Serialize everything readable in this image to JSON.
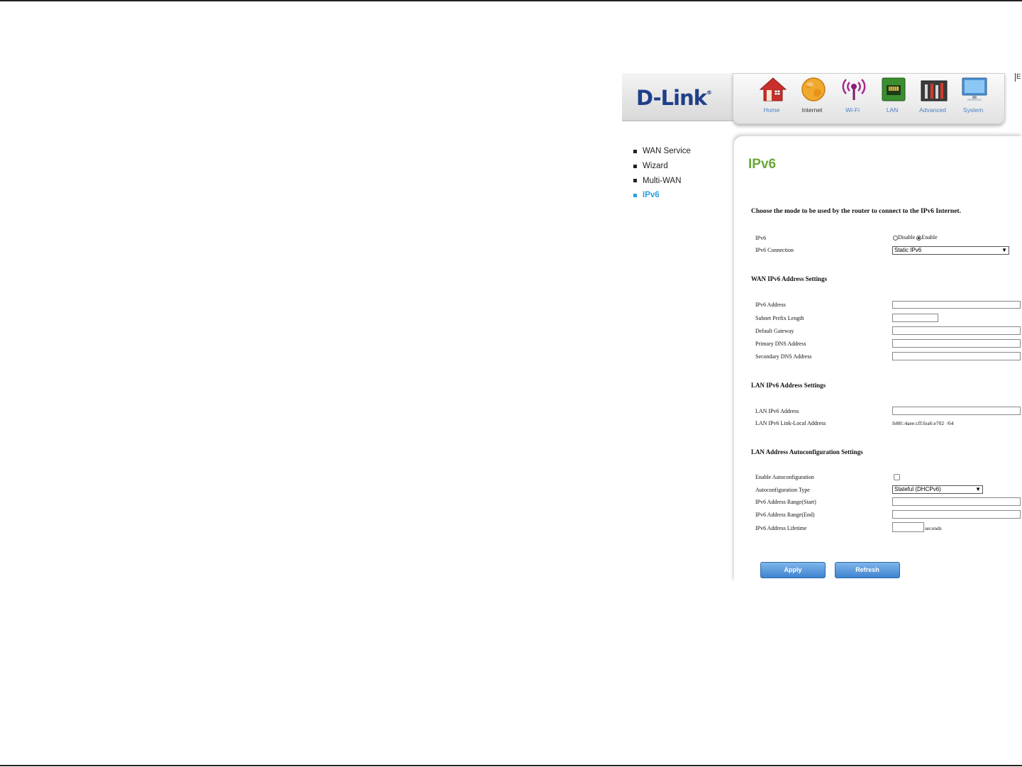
{
  "brand": {
    "logo_text": "D-Link",
    "logo_mark": "®"
  },
  "nav": [
    {
      "label": "Home",
      "icon": "home-icon"
    },
    {
      "label": "Internet",
      "icon": "globe-icon",
      "active": true
    },
    {
      "label": "Wi-Fi",
      "icon": "wifi-icon"
    },
    {
      "label": "LAN",
      "icon": "lan-port-icon"
    },
    {
      "label": "Advanced",
      "icon": "tools-icon"
    },
    {
      "label": "System",
      "icon": "monitor-icon"
    }
  ],
  "corner_text": "E",
  "sidebar": {
    "items": [
      {
        "label": "WAN Service"
      },
      {
        "label": "Wizard"
      },
      {
        "label": "Multi-WAN"
      },
      {
        "label": "IPv6",
        "active": true
      }
    ]
  },
  "page": {
    "title": "IPv6",
    "intro": "Choose the mode to be used by the router to connect to the IPv6 Internet."
  },
  "ipv6": {
    "label": "IPv6",
    "disable_label": "Disable",
    "enable_label": "Enable",
    "selected": "Enable",
    "connection_label": "IPv6 Connection",
    "connection_value": "Static IPv6"
  },
  "wan": {
    "heading": "WAN IPv6 Address Settings",
    "address_label": "IPv6 Address",
    "prefix_label": "Subnet Prefix Length",
    "gateway_label": "Default Gateway",
    "primary_dns_label": "Primary DNS Address",
    "secondary_dns_label": "Secondary DNS Address"
  },
  "lan": {
    "heading": "LAN IPv6 Address Settings",
    "address_label": "LAN IPv6 Address",
    "link_local_label": "LAN IPv6 Link-Local Address",
    "link_local_value": "fe80::4aee:cff:fea6:e702  /64"
  },
  "autoconf": {
    "heading": "LAN Address Autoconfiguration Settings",
    "enable_label": "Enable Autoconfiguration",
    "enabled": false,
    "type_label": "Autoconfiguration Type",
    "type_value": "Stateful (DHCPv6)",
    "range_start_label": "IPv6 Address Range(Start)",
    "range_end_label": "IPv6 Address Range(End)",
    "lifetime_label": "IPv6 Address Lifetime",
    "lifetime_unit": "seconds"
  },
  "buttons": {
    "apply": "Apply",
    "refresh": "Refresh"
  },
  "colors": {
    "accent_green": "#6aa835",
    "link_blue": "#2aa0dc",
    "brand_blue": "#1f3f8a",
    "button_blue": "#3f83cf"
  }
}
